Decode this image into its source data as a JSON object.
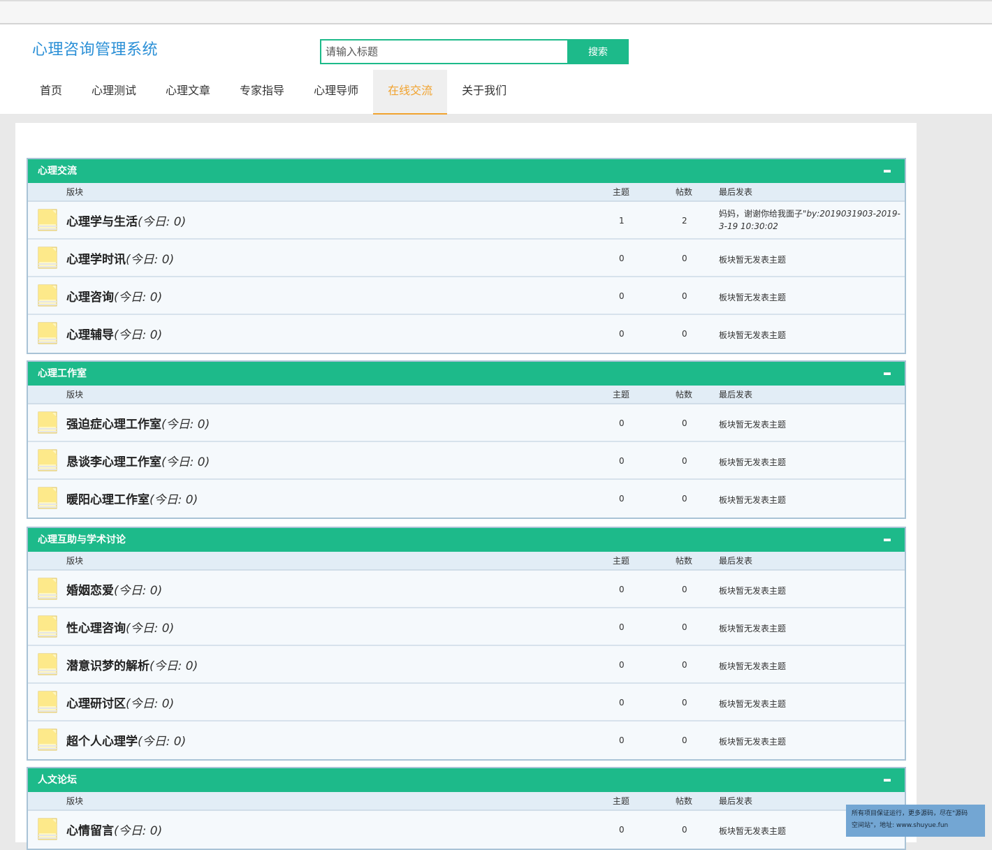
{
  "brand": "心理咨询管理系统",
  "search": {
    "placeholder": "请输入标题",
    "button": "搜索"
  },
  "nav": [
    {
      "label": "首页"
    },
    {
      "label": "心理测试"
    },
    {
      "label": "心理文章"
    },
    {
      "label": "专家指导"
    },
    {
      "label": "心理导师"
    },
    {
      "label": "在线交流",
      "active": true
    },
    {
      "label": "关于我们"
    }
  ],
  "columns": {
    "board": "版块",
    "topics": "主题",
    "posts": "帖数",
    "last": "最后发表"
  },
  "sections": [
    {
      "title": "心理交流",
      "rows": [
        {
          "name": "心理学与生活",
          "today": "(今日: 0)",
          "topics": "1",
          "posts": "2",
          "last_line1": "妈妈，谢谢你给我面子\"",
          "last_by": "by:2019031903-2019-3-19 10:30:02"
        },
        {
          "name": "心理学时讯",
          "today": "(今日: 0)",
          "topics": "0",
          "posts": "0",
          "last": "板块暂无发表主题"
        },
        {
          "name": "心理咨询",
          "today": "(今日: 0)",
          "topics": "0",
          "posts": "0",
          "last": "板块暂无发表主题"
        },
        {
          "name": "心理辅导",
          "today": "(今日: 0)",
          "topics": "0",
          "posts": "0",
          "last": "板块暂无发表主题"
        }
      ]
    },
    {
      "title": "心理工作室",
      "rows": [
        {
          "name": "强迫症心理工作室",
          "today": "(今日: 0)",
          "topics": "0",
          "posts": "0",
          "last": "板块暂无发表主题"
        },
        {
          "name": "恳谈李心理工作室",
          "today": "(今日: 0)",
          "topics": "0",
          "posts": "0",
          "last": "板块暂无发表主题"
        },
        {
          "name": "暖阳心理工作室",
          "today": "(今日: 0)",
          "topics": "0",
          "posts": "0",
          "last": "板块暂无发表主题"
        }
      ]
    },
    {
      "title": "心理互助与学术讨论",
      "rows": [
        {
          "name": "婚姻恋爱",
          "today": "(今日: 0)",
          "topics": "0",
          "posts": "0",
          "last": "板块暂无发表主题"
        },
        {
          "name": "性心理咨询",
          "today": "(今日: 0)",
          "topics": "0",
          "posts": "0",
          "last": "板块暂无发表主题"
        },
        {
          "name": "潜意识梦的解析",
          "today": "(今日: 0)",
          "topics": "0",
          "posts": "0",
          "last": "板块暂无发表主题"
        },
        {
          "name": "心理研讨区",
          "today": "(今日: 0)",
          "topics": "0",
          "posts": "0",
          "last": "板块暂无发表主题"
        },
        {
          "name": "超个人心理学",
          "today": "(今日: 0)",
          "topics": "0",
          "posts": "0",
          "last": "板块暂无发表主题"
        }
      ]
    },
    {
      "title": "人文论坛",
      "rows": [
        {
          "name": "心情留言",
          "today": "(今日: 0)",
          "topics": "0",
          "posts": "0",
          "last": "板块暂无发表主题"
        }
      ]
    }
  ],
  "notice": {
    "line1": "所有项目保证运行，更多源码，尽在\"源码",
    "line2": "空间站\"，地址: www.shuyue.fun"
  },
  "colors": {
    "accent": "#1dba8a",
    "brand": "#2a8fd6",
    "nav_active": "#f1a32f"
  }
}
